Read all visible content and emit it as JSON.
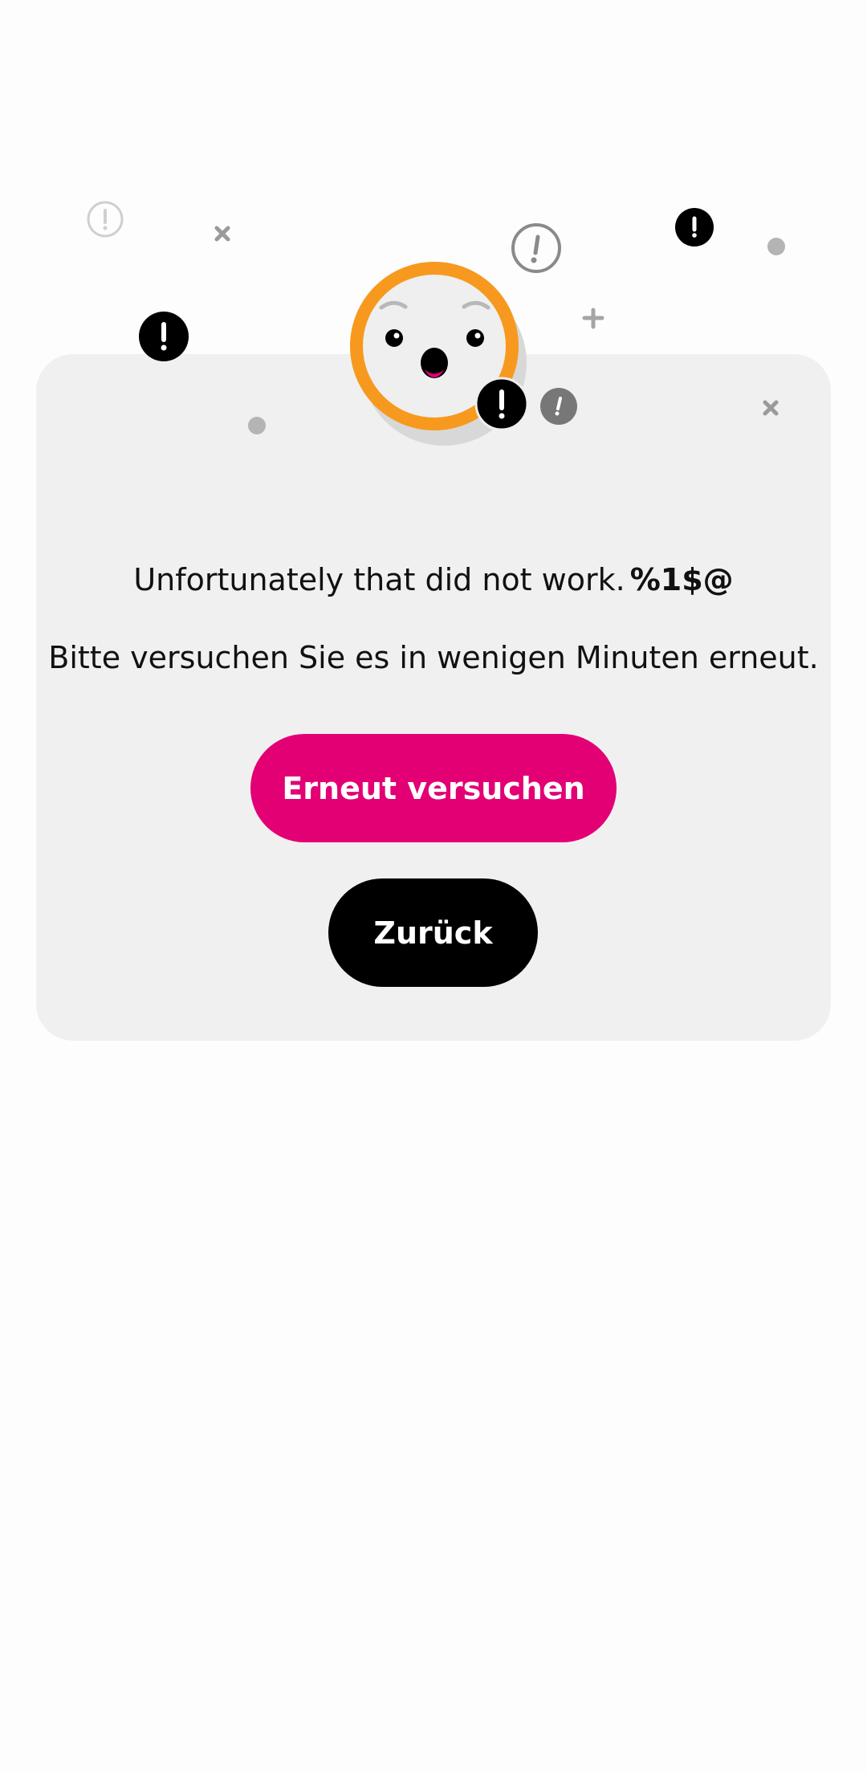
{
  "error": {
    "title": "Unfortunately that did not work.",
    "code": "%1$@",
    "subtitle": "Bitte versuchen Sie es in wenigen Minuten erneut."
  },
  "actions": {
    "retry_label": "Erneut versuchen",
    "back_label": "Zurück"
  },
  "illustration": {
    "face": "surprised-face",
    "icons": [
      "exclamation-icon",
      "close-icon",
      "plus-icon",
      "dot-icon"
    ]
  },
  "colors": {
    "accent": "#e20074",
    "face_ring": "#f7991e",
    "card_background": "#f0f0f0",
    "back_button": "#000000"
  }
}
